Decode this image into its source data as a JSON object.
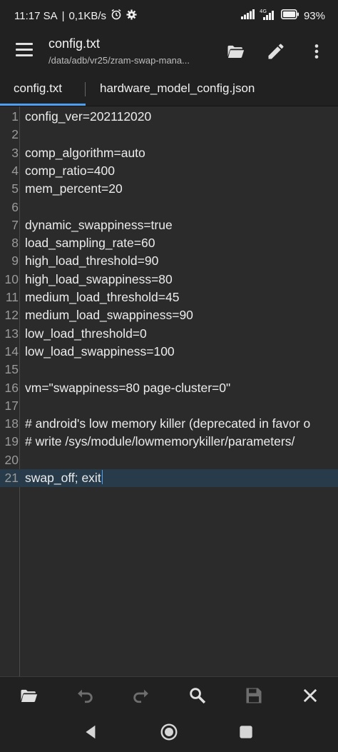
{
  "status_bar": {
    "time": "11:17 SA",
    "separator": "|",
    "speed": "0,1KB/s",
    "battery": "93"
  },
  "app_bar": {
    "title": "config.txt",
    "subtitle": "/data/adb/vr25/zram-swap-mana..."
  },
  "tabs": [
    {
      "label": "config.txt",
      "active": true
    },
    {
      "label": "hardware_model_config.json",
      "active": false
    }
  ],
  "editor": {
    "lines": [
      {
        "num": "1",
        "text": "config_ver=202112020"
      },
      {
        "num": "2",
        "text": ""
      },
      {
        "num": "3",
        "text": "comp_algorithm=auto"
      },
      {
        "num": "4",
        "text": "comp_ratio=400"
      },
      {
        "num": "5",
        "text": "mem_percent=20"
      },
      {
        "num": "6",
        "text": ""
      },
      {
        "num": "7",
        "text": "dynamic_swappiness=true"
      },
      {
        "num": "8",
        "text": "load_sampling_rate=60"
      },
      {
        "num": "9",
        "text": "high_load_threshold=90"
      },
      {
        "num": "10",
        "text": "high_load_swappiness=80"
      },
      {
        "num": "11",
        "text": "medium_load_threshold=45"
      },
      {
        "num": "12",
        "text": "medium_load_swappiness=90"
      },
      {
        "num": "13",
        "text": "low_load_threshold=0"
      },
      {
        "num": "14",
        "text": "low_load_swappiness=100"
      },
      {
        "num": "15",
        "text": ""
      },
      {
        "num": "16",
        "text": "vm=\"swappiness=80 page-cluster=0\""
      },
      {
        "num": "17",
        "text": ""
      },
      {
        "num": "18",
        "text": "# android's low memory killer (deprecated in favor o"
      },
      {
        "num": "19",
        "text": "# write /sys/module/lowmemorykiller/parameters/"
      },
      {
        "num": "20",
        "text": ""
      },
      {
        "num": "21",
        "text": "swap_off; exit"
      }
    ],
    "active_line": 21
  },
  "icons": {
    "menu": "menu-icon",
    "open_folder": "folder-open-icon",
    "edit": "pencil-icon",
    "more": "more-vert-icon",
    "undo": "undo-icon",
    "redo": "redo-icon",
    "search": "search-icon",
    "save": "save-icon",
    "close": "close-icon"
  },
  "colors": {
    "accent": "#4f9ff0",
    "background": "#2b2b2b",
    "bar": "#212121",
    "active_line": "#273b4a"
  }
}
